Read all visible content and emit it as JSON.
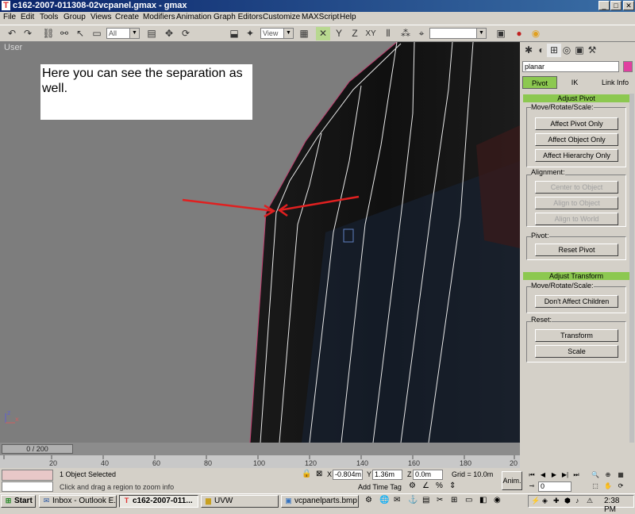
{
  "window": {
    "title": "c162-2007-011308-02vcpanel.gmax - gmax"
  },
  "menu": [
    "File",
    "Edit",
    "Tools",
    "Group",
    "Views",
    "Create",
    "Modifiers",
    "Animation",
    "Graph Editors",
    "Customize",
    "MAXScript",
    "Help"
  ],
  "toolbar": {
    "selection_filter": "All",
    "ref_coord": "View",
    "named_selection": ""
  },
  "viewport": {
    "label": "User",
    "note": "Here you can see the separation as well."
  },
  "panel": {
    "modifier_name": "planar",
    "color_swatch": "#e040a0",
    "tabs": [
      "Pivot",
      "IK",
      "Link Info"
    ],
    "adjust_pivot": {
      "header": "Adjust Pivot",
      "group_move": "Move/Rotate/Scale:",
      "btn_pivot_only": "Affect Pivot Only",
      "btn_object_only": "Affect Object Only",
      "btn_hierarchy_only": "Affect Hierarchy Only",
      "group_alignment": "Alignment:",
      "btn_center_object": "Center to Object",
      "btn_align_object": "Align to Object",
      "btn_align_world": "Align to World",
      "group_pivot": "Pivot:",
      "btn_reset_pivot": "Reset Pivot"
    },
    "adjust_transform": {
      "header": "Adjust Transform",
      "group_move": "Move/Rotate/Scale:",
      "btn_dont_affect": "Don't Affect Children",
      "group_reset": "Reset:",
      "btn_transform": "Transform",
      "btn_scale": "Scale"
    }
  },
  "timeline": {
    "slider_label": "0 / 200",
    "ticks": [
      "20",
      "40",
      "60",
      "80",
      "100",
      "120",
      "140",
      "160",
      "180",
      "20"
    ]
  },
  "status": {
    "selected": "1 Object Selected",
    "prompt": "Click and drag a region to zoom info",
    "x_value": "-0.804m",
    "y_value": "1.36m",
    "z_value": "0.0m",
    "x_label": "X",
    "y_label": "Y",
    "z_label": "Z",
    "grid": "Grid = 10.0m",
    "add_time_tag": "Add Time Tag",
    "anim": "Anim.",
    "frame": "0"
  },
  "taskbar": {
    "start": "Start",
    "items": [
      "Inbox - Outlook E...",
      "c162-2007-011...",
      "UVW",
      "vcpanelparts.bmp ..."
    ],
    "clock": "2:38 PM"
  }
}
